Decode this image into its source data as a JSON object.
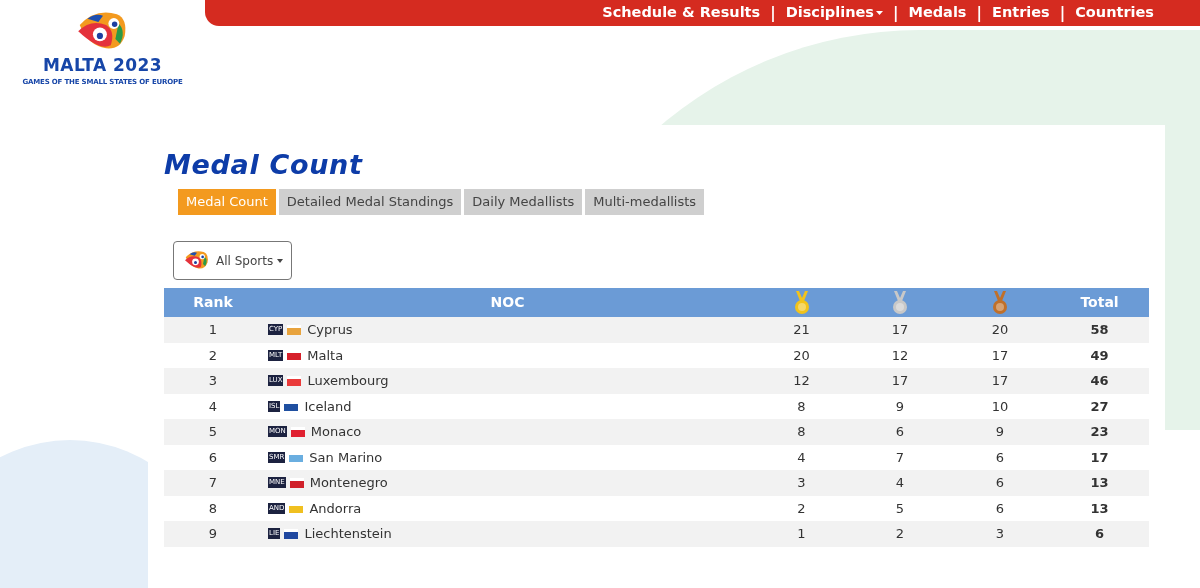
{
  "logo": {
    "title": "MALTA 2023",
    "subtitle": "GAMES OF THE SMALL STATES OF EUROPE"
  },
  "nav": [
    {
      "label": "Schedule & Results",
      "dropdown": false
    },
    {
      "label": "Disciplines",
      "dropdown": true
    },
    {
      "label": "Medals",
      "dropdown": false
    },
    {
      "label": "Entries",
      "dropdown": false
    },
    {
      "label": "Countries",
      "dropdown": false
    }
  ],
  "nav_separator": "|",
  "heading": "Medal Count",
  "tabs": [
    {
      "label": "Medal Count",
      "selected": true
    },
    {
      "label": "Detailed Medal Standings",
      "selected": false
    },
    {
      "label": "Daily Medallists",
      "selected": false
    },
    {
      "label": "Multi-medallists",
      "selected": false
    }
  ],
  "sport_filter": {
    "label": "All Sports"
  },
  "table": {
    "columns": [
      {
        "kind": "text",
        "label": "Rank"
      },
      {
        "kind": "text",
        "label": "NOC"
      },
      {
        "kind": "medal",
        "color": "#f2c31b"
      },
      {
        "kind": "medal",
        "color": "#c8c8c8"
      },
      {
        "kind": "medal",
        "color": "#c0702a"
      },
      {
        "kind": "text",
        "label": "Total"
      }
    ],
    "rows": [
      {
        "rank": "1",
        "code": "CYP",
        "color": "#e8a33d",
        "noc": "Cyprus",
        "gold": "21",
        "silver": "17",
        "bronze": "20",
        "total": "58"
      },
      {
        "rank": "2",
        "code": "MLT",
        "color": "#d6202a",
        "noc": "Malta",
        "gold": "20",
        "silver": "12",
        "bronze": "17",
        "total": "49"
      },
      {
        "rank": "3",
        "code": "LUX",
        "color": "#ea3a3a",
        "noc": "Luxembourg",
        "gold": "12",
        "silver": "17",
        "bronze": "17",
        "total": "46"
      },
      {
        "rank": "4",
        "code": "ISL",
        "color": "#1f4fa0",
        "noc": "Iceland",
        "gold": "8",
        "silver": "9",
        "bronze": "10",
        "total": "27"
      },
      {
        "rank": "5",
        "code": "MON",
        "color": "#e02030",
        "noc": "Monaco",
        "gold": "8",
        "silver": "6",
        "bronze": "9",
        "total": "23"
      },
      {
        "rank": "6",
        "code": "SMR",
        "color": "#6aaee0",
        "noc": "San Marino",
        "gold": "4",
        "silver": "7",
        "bronze": "6",
        "total": "17"
      },
      {
        "rank": "7",
        "code": "MNE",
        "color": "#d0202a",
        "noc": "Montenegro",
        "gold": "3",
        "silver": "4",
        "bronze": "6",
        "total": "13"
      },
      {
        "rank": "8",
        "code": "AND",
        "color": "#f0c020",
        "noc": "Andorra",
        "gold": "2",
        "silver": "5",
        "bronze": "6",
        "total": "13"
      },
      {
        "rank": "9",
        "code": "LIE",
        "color": "#2048a0",
        "noc": "Liechtenstein",
        "gold": "1",
        "silver": "2",
        "bronze": "3",
        "total": "6"
      }
    ]
  }
}
